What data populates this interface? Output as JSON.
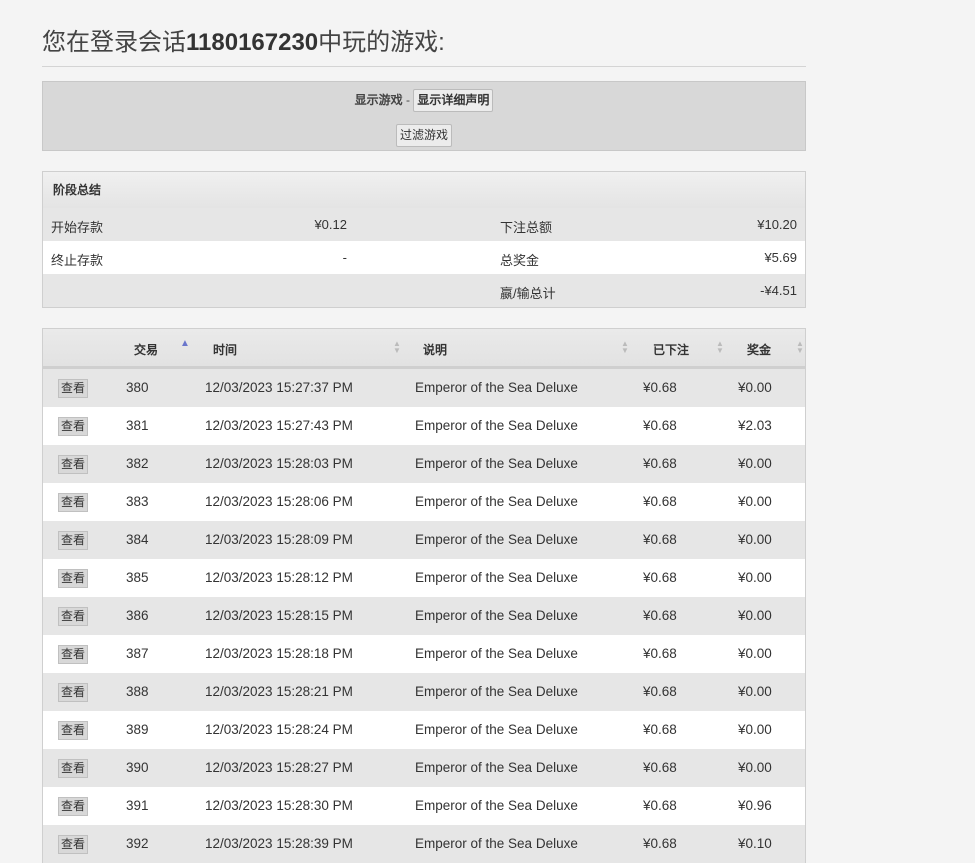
{
  "heading": {
    "prefix": "您在登录会话",
    "session_id": "1180167230",
    "suffix": "中玩的游戏:"
  },
  "filter": {
    "show_label": "显示游戏",
    "separator": " - ",
    "details_button": "显示详细声明",
    "filter_button": "过滤游戏"
  },
  "summary": {
    "title": "阶段总结",
    "start_balance_label": "开始存款",
    "start_balance": "¥0.12",
    "end_balance_label": "终止存款",
    "end_balance": "-",
    "total_bet_label": "下注总额",
    "total_bet": "¥10.20",
    "total_win_label": "总奖金",
    "total_win": "¥5.69",
    "net_label": "嬴/输总计",
    "net": "-¥4.51"
  },
  "table": {
    "columns": [
      "交易",
      "时间",
      "说明",
      "已下注",
      "奖金"
    ],
    "view_label": "查看",
    "rows": [
      {
        "id": "380",
        "time": "12/03/2023 15:27:37 PM",
        "desc": "Emperor of the Sea Deluxe",
        "bet": "¥0.68",
        "win": "¥0.00"
      },
      {
        "id": "381",
        "time": "12/03/2023 15:27:43 PM",
        "desc": "Emperor of the Sea Deluxe",
        "bet": "¥0.68",
        "win": "¥2.03"
      },
      {
        "id": "382",
        "time": "12/03/2023 15:28:03 PM",
        "desc": "Emperor of the Sea Deluxe",
        "bet": "¥0.68",
        "win": "¥0.00"
      },
      {
        "id": "383",
        "time": "12/03/2023 15:28:06 PM",
        "desc": "Emperor of the Sea Deluxe",
        "bet": "¥0.68",
        "win": "¥0.00"
      },
      {
        "id": "384",
        "time": "12/03/2023 15:28:09 PM",
        "desc": "Emperor of the Sea Deluxe",
        "bet": "¥0.68",
        "win": "¥0.00"
      },
      {
        "id": "385",
        "time": "12/03/2023 15:28:12 PM",
        "desc": "Emperor of the Sea Deluxe",
        "bet": "¥0.68",
        "win": "¥0.00"
      },
      {
        "id": "386",
        "time": "12/03/2023 15:28:15 PM",
        "desc": "Emperor of the Sea Deluxe",
        "bet": "¥0.68",
        "win": "¥0.00"
      },
      {
        "id": "387",
        "time": "12/03/2023 15:28:18 PM",
        "desc": "Emperor of the Sea Deluxe",
        "bet": "¥0.68",
        "win": "¥0.00"
      },
      {
        "id": "388",
        "time": "12/03/2023 15:28:21 PM",
        "desc": "Emperor of the Sea Deluxe",
        "bet": "¥0.68",
        "win": "¥0.00"
      },
      {
        "id": "389",
        "time": "12/03/2023 15:28:24 PM",
        "desc": "Emperor of the Sea Deluxe",
        "bet": "¥0.68",
        "win": "¥0.00"
      },
      {
        "id": "390",
        "time": "12/03/2023 15:28:27 PM",
        "desc": "Emperor of the Sea Deluxe",
        "bet": "¥0.68",
        "win": "¥0.00"
      },
      {
        "id": "391",
        "time": "12/03/2023 15:28:30 PM",
        "desc": "Emperor of the Sea Deluxe",
        "bet": "¥0.68",
        "win": "¥0.96"
      },
      {
        "id": "392",
        "time": "12/03/2023 15:28:39 PM",
        "desc": "Emperor of the Sea Deluxe",
        "bet": "¥0.68",
        "win": "¥0.10"
      }
    ]
  },
  "icons": {
    "sort_asc": "sort-ascending-icon",
    "sort_both": "sort-both-icon"
  }
}
